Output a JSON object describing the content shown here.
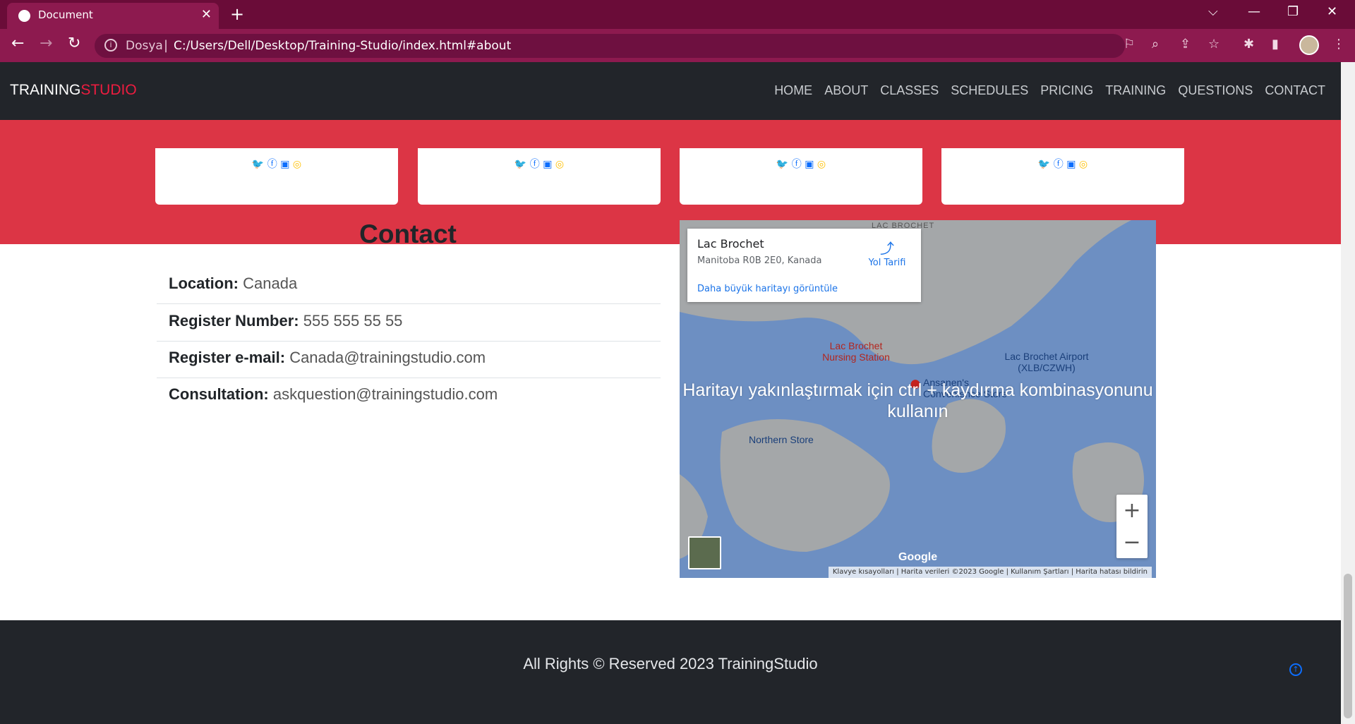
{
  "browser": {
    "tab_title": "Document",
    "tab_close": "✕",
    "new_tab": "+",
    "win_controls": {
      "dropdown": "⌵",
      "minimize": "—",
      "restore": "❐",
      "close": "✕"
    },
    "security_label": "Dosya",
    "url": "C:/Users/Dell/Desktop/Training-Studio/index.html#about"
  },
  "site": {
    "logo_main": "TRAINING",
    "logo_accent": "STUDIO",
    "nav": [
      "HOME",
      "ABOUT",
      "CLASSES",
      "SCHEDULES",
      "PRICING",
      "TRAINING",
      "QUESTIONS",
      "CONTACT"
    ]
  },
  "contact": {
    "title": "Contact",
    "rows": [
      {
        "label": "Location:",
        "value": "Canada"
      },
      {
        "label": "Register Number:",
        "value": "555 555 55 55"
      },
      {
        "label": "Register e-mail:",
        "value": "Canada@trainingstudio.com"
      },
      {
        "label": "Consultation:",
        "value": "askquestion@trainingstudio.com"
      }
    ]
  },
  "map": {
    "place_name": "Lac Brochet",
    "address": "Manitoba R0B 2E0, Kanada",
    "larger_map_link": "Daha büyük haritayı görüntüle",
    "directions": "Yol Tarifi",
    "overlay_message": "Haritayı yakınlaştırmak için ctrl + kaydırma kombinasyonunu kullanın",
    "top_label": "LAC BROCHET",
    "labels": {
      "nursing": "Lac Brochet Nursing Station",
      "airport": "Lac Brochet Airport (XLB/CZWH)",
      "store": "Ansanen's Convenience Store",
      "northern": "Northern Store"
    },
    "zoom_in": "+",
    "zoom_out": "−",
    "google": "Google",
    "footer": {
      "shortcuts": "Klavye kısayolları",
      "data": "Harita verileri ©2023 Google",
      "terms": "Kullanım Şartları",
      "report": "Harita hatası bildirin"
    },
    "colors": {
      "water": "#6d8fc2",
      "land": "#a4a7a9"
    }
  },
  "footer": {
    "text": "All Rights © Reserved 2023 TrainingStudio"
  },
  "colors": {
    "browser_frame": "#6a0c38",
    "accent_red": "#dc3545",
    "navbar": "#22252a",
    "link_blue": "#0d6efd"
  }
}
